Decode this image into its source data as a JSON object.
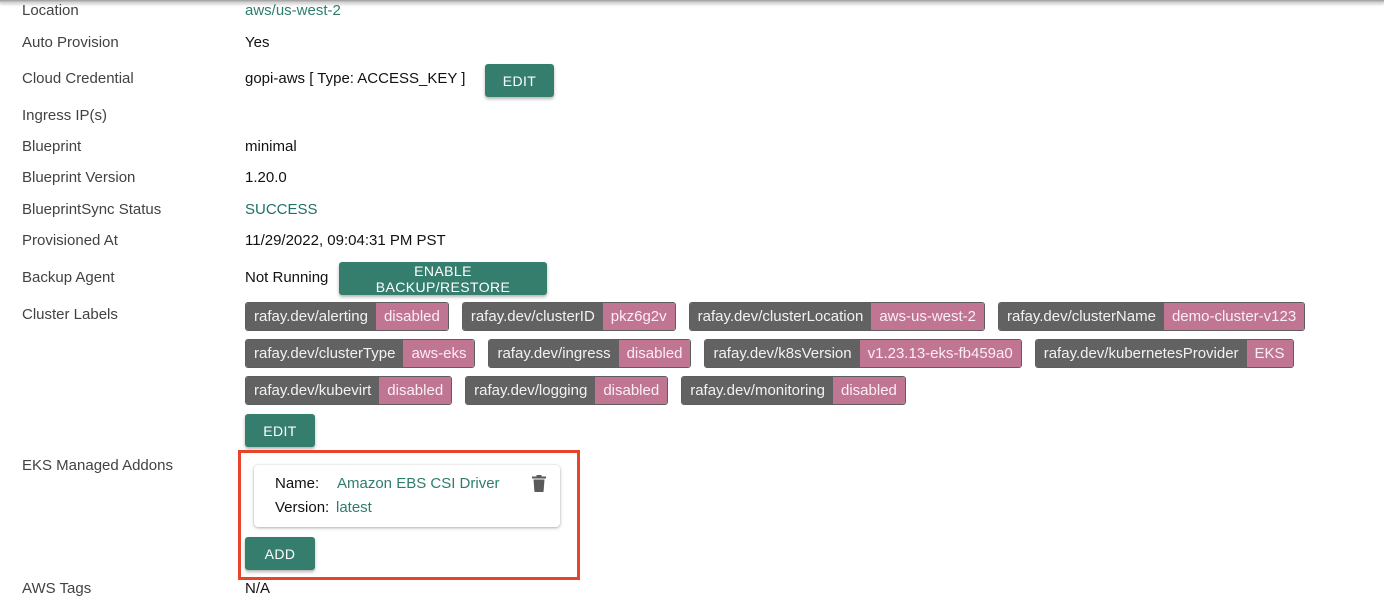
{
  "details": {
    "location": {
      "label": "Location",
      "value": "aws/us-west-2"
    },
    "auto_provision": {
      "label": "Auto Provision",
      "value": "Yes"
    },
    "cloud_credential": {
      "label": "Cloud Credential",
      "value": "gopi-aws [ Type: ACCESS_KEY ]",
      "edit_label": "EDIT"
    },
    "ingress_ips": {
      "label": "Ingress IP(s)",
      "value": ""
    },
    "blueprint": {
      "label": "Blueprint",
      "value": "minimal"
    },
    "blueprint_version": {
      "label": "Blueprint Version",
      "value": "1.20.0"
    },
    "blueprint_sync_status": {
      "label": "BlueprintSync Status",
      "value": "SUCCESS"
    },
    "provisioned_at": {
      "label": "Provisioned At",
      "value": "11/29/2022, 09:04:31 PM PST"
    },
    "backup_agent": {
      "label": "Backup Agent",
      "value": "Not Running",
      "button_label": "ENABLE BACKUP/RESTORE"
    },
    "cluster_labels": {
      "label": "Cluster Labels",
      "edit_label": "EDIT",
      "rows": [
        [
          {
            "key": "rafay.dev/alerting",
            "value": "disabled"
          },
          {
            "key": "rafay.dev/clusterID",
            "value": "pkz6g2v"
          },
          {
            "key": "rafay.dev/clusterLocation",
            "value": "aws-us-west-2"
          },
          {
            "key": "rafay.dev/clusterName",
            "value": "demo-cluster-v123"
          }
        ],
        [
          {
            "key": "rafay.dev/clusterType",
            "value": "aws-eks"
          },
          {
            "key": "rafay.dev/ingress",
            "value": "disabled"
          },
          {
            "key": "rafay.dev/k8sVersion",
            "value": "v1.23.13-eks-fb459a0"
          },
          {
            "key": "rafay.dev/kubernetesProvider",
            "value": "EKS"
          }
        ],
        [
          {
            "key": "rafay.dev/kubevirt",
            "value": "disabled"
          },
          {
            "key": "rafay.dev/logging",
            "value": "disabled"
          },
          {
            "key": "rafay.dev/monitoring",
            "value": "disabled"
          }
        ]
      ]
    },
    "eks_addons": {
      "label": "EKS Managed Addons",
      "name_label": "Name:",
      "version_label": "Version:",
      "items": [
        {
          "name": "Amazon EBS CSI Driver",
          "version": "latest"
        }
      ],
      "add_label": "ADD"
    },
    "aws_tags": {
      "label": "AWS Tags",
      "value": "N/A"
    }
  },
  "colors": {
    "accent": "#357e6e",
    "link": "#2e7d6b",
    "label_key_bg": "#626262",
    "label_value_bg": "#c07592",
    "highlight": "#e8442a"
  }
}
